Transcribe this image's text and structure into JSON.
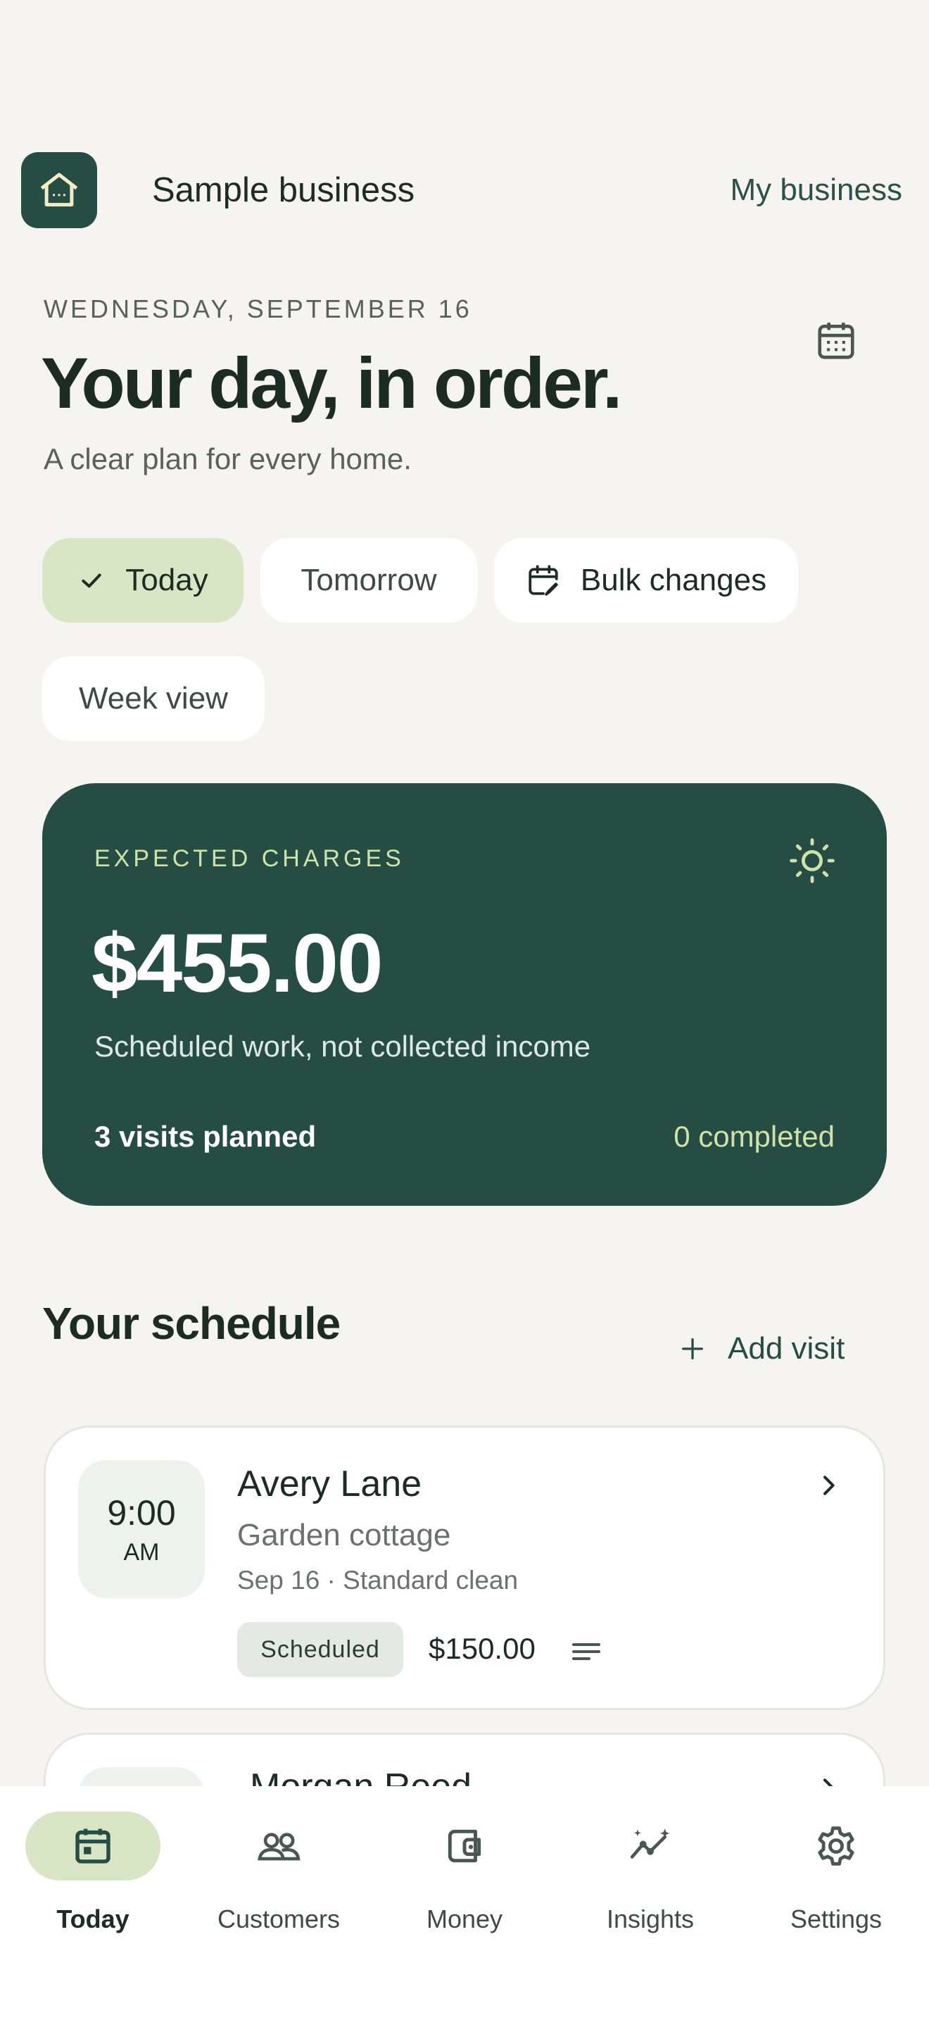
{
  "header": {
    "business_name": "Sample business",
    "my_business_label": "My business",
    "logo_icon": "home-icon"
  },
  "hero": {
    "date": "WEDNESDAY, SEPTEMBER 16",
    "title": "Your day, in order.",
    "subtitle": "A clear plan for every home."
  },
  "filters": {
    "today": "Today",
    "tomorrow": "Tomorrow",
    "bulk": "Bulk changes",
    "week": "Week view",
    "selected": "Today"
  },
  "summary": {
    "label": "EXPECTED CHARGES",
    "amount": "$455.00",
    "note": "Scheduled work, not collected income",
    "visits": "3 visits planned",
    "completed": "0 completed"
  },
  "schedule": {
    "title": "Your schedule",
    "add_label": "Add visit",
    "visits": [
      {
        "time": "9:00",
        "ampm": "AM",
        "name": "Avery Lane",
        "place": "Garden cottage",
        "meta": "Sep 16 · Standard clean",
        "status": "Scheduled",
        "price": "$150.00"
      },
      {
        "name": "Morgan Reed"
      }
    ]
  },
  "tabs": [
    {
      "label": "Today",
      "icon": "calendar-icon",
      "active": true
    },
    {
      "label": "Customers",
      "icon": "people-icon"
    },
    {
      "label": "Money",
      "icon": "wallet-icon"
    },
    {
      "label": "Insights",
      "icon": "sparkle-chart-icon"
    },
    {
      "label": "Settings",
      "icon": "gear-icon"
    }
  ],
  "colors": {
    "brand": "#264d44",
    "accent": "#d8e6c5",
    "background": "#f5f4f0",
    "highlight": "#cfe3a9"
  }
}
